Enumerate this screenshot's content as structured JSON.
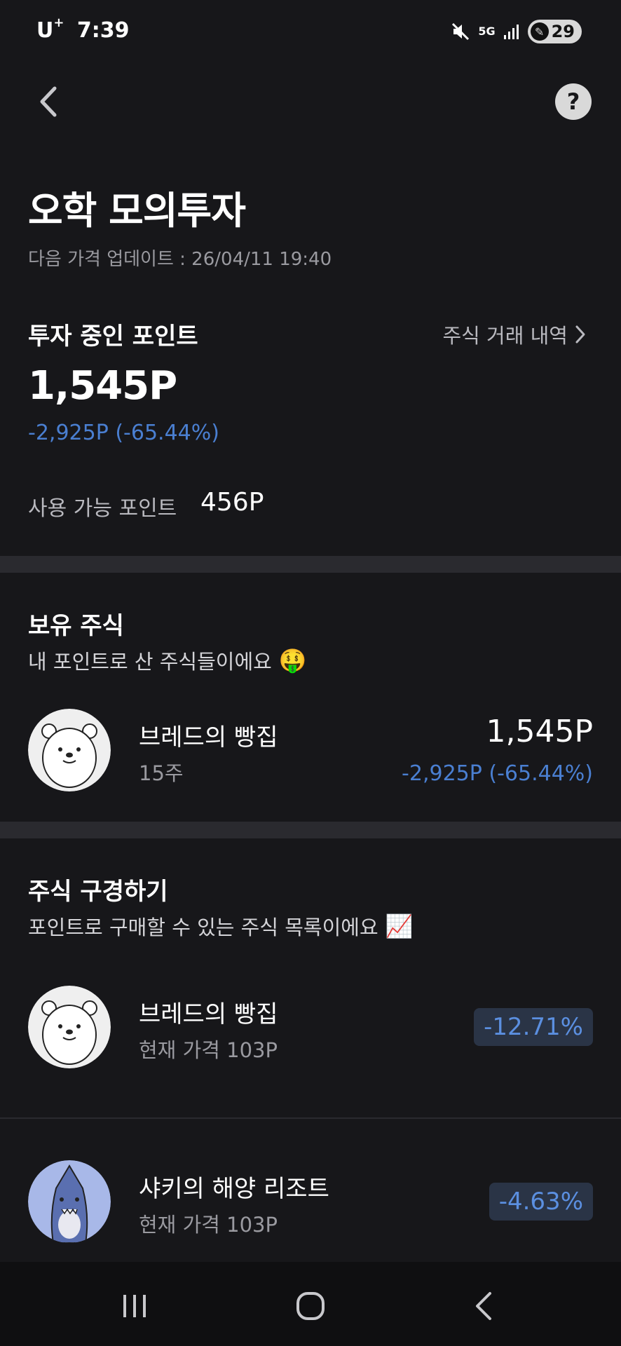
{
  "status_bar": {
    "carrier": "U",
    "carrier_sup": "+",
    "time": "7:39",
    "network": "5G",
    "battery": "29"
  },
  "header": {
    "help_label": "?"
  },
  "page": {
    "title": "오학 모의투자",
    "update_line": "다음 가격 업데이트 : 26/04/11 19:40"
  },
  "investing": {
    "label": "투자 중인 포인트",
    "history_link": "주식 거래 내역",
    "total": "1,545P",
    "change": "-2,925P (-65.44%)",
    "available_label": "사용 가능 포인트",
    "available_value": "456P"
  },
  "holdings": {
    "title": "보유 주식",
    "subtitle": "내 포인트로 산 주식들이에요",
    "subtitle_emoji": "🤑",
    "items": [
      {
        "name": "브레드의 빵집",
        "shares": "15주",
        "value": "1,545P",
        "change": "-2,925P (-65.44%)"
      }
    ]
  },
  "browse": {
    "title": "주식 구경하기",
    "subtitle": "포인트로 구매할 수 있는 주식 목록이에요",
    "subtitle_emoji": "📈",
    "items": [
      {
        "name": "브레드의 빵집",
        "price": "현재 가격 103P",
        "change_pct": "-12.71%"
      },
      {
        "name": "샤키의 해양 리조트",
        "price": "현재 가격 103P",
        "change_pct": "-4.63%"
      }
    ]
  },
  "colors": {
    "background": "#17171a",
    "negative": "#4a7fd1",
    "badge_bg": "#2a3446"
  }
}
